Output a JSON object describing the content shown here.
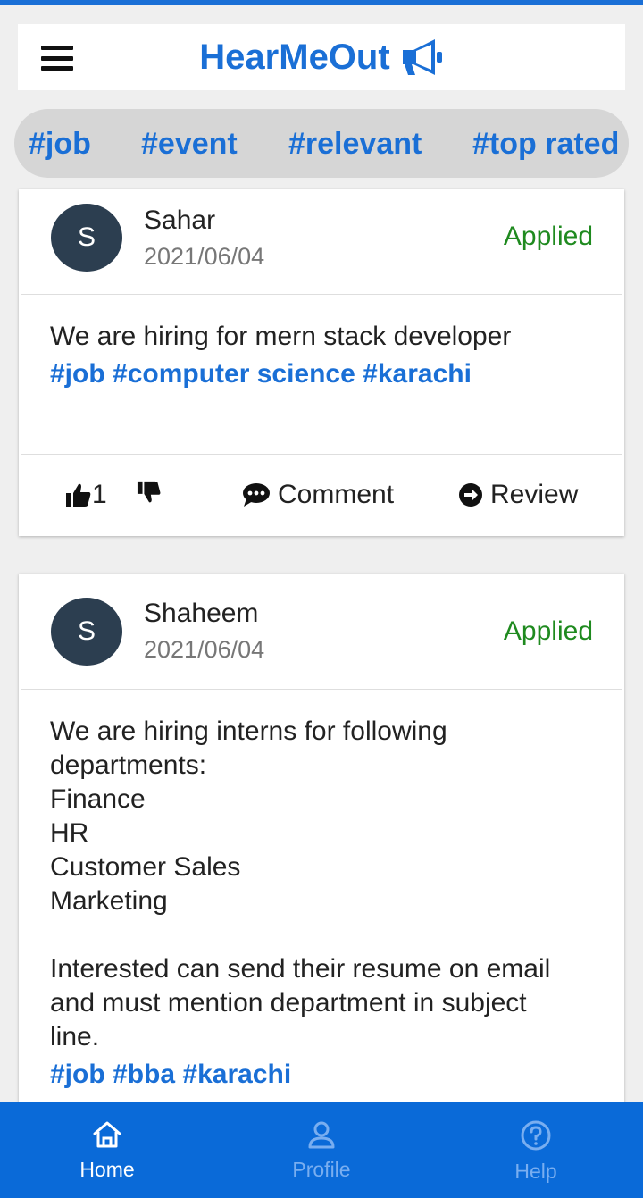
{
  "app": {
    "title": "HearMeOut"
  },
  "filters": [
    "#job",
    "#event",
    "#relevant",
    "#top rated"
  ],
  "posts": [
    {
      "avatar_initial": "S",
      "author": "Sahar",
      "date": "2021/06/04",
      "status": "Applied",
      "body_lines": [
        "We are hiring for mern stack developer"
      ],
      "tags": [
        "#job",
        "#computer science",
        "#karachi"
      ],
      "likes": "1",
      "comment_label": "Comment",
      "review_label": "Review"
    },
    {
      "avatar_initial": "S",
      "author": "Shaheem",
      "date": "2021/06/04",
      "status": "Applied",
      "body_lines": [
        "We are hiring interns for following",
        "departments:",
        "Finance",
        "HR",
        "Customer Sales",
        "Marketing",
        "",
        "Interested can send their resume on email",
        "and must mention department in subject",
        "line."
      ],
      "tags": [
        "#job",
        "#bba",
        "#karachi"
      ]
    }
  ],
  "nav": [
    {
      "label": "Home",
      "icon": "home-icon",
      "active": true
    },
    {
      "label": "Profile",
      "icon": "person-icon",
      "active": false
    },
    {
      "label": "Help",
      "icon": "help-icon",
      "active": false
    }
  ],
  "colors": {
    "primary": "#1a6fd6",
    "applied": "#1f8a1f",
    "avatar": "#2c3e50",
    "nav_bg": "#0a6ad8"
  }
}
